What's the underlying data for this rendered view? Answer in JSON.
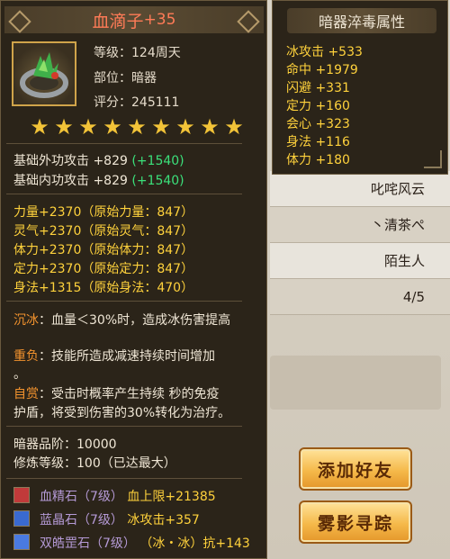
{
  "background": {
    "rows": [
      "叱咤风云",
      "丶清茶ぺ",
      "陌生人",
      "4/5"
    ],
    "buttons": {
      "add_friend": "添加好友",
      "track": "雾影寻踪"
    }
  },
  "tooltip": {
    "title": "血滴子",
    "title_plus": "+35",
    "level_label": "等级：",
    "level_value": "124周天",
    "slot_label": "部位：",
    "slot_value": "暗器",
    "score_label": "评分：",
    "score_value": "245111",
    "stars": [
      "★",
      "★",
      "★",
      "★",
      "★",
      "★",
      "★",
      "★",
      "★"
    ],
    "base_ext_attack": {
      "label": "基础外功攻击",
      "value": "+829",
      "bonus": "(+1540)"
    },
    "base_int_attack": {
      "label": "基础内功攻击",
      "value": "+829",
      "bonus": "(+1540)"
    },
    "attrs": [
      {
        "name": "力量",
        "value": "+2370",
        "orig": "（原始力量：",
        "orig_value": "847",
        "close": "）"
      },
      {
        "name": "灵气",
        "value": "+2370",
        "orig": "（原始灵气：",
        "orig_value": "847",
        "close": "）"
      },
      {
        "name": "体力",
        "value": "+2370",
        "orig": "（原始体力：",
        "orig_value": "847",
        "close": "）"
      },
      {
        "name": "定力",
        "value": "+2370",
        "orig": "（原始定力：",
        "orig_value": "847",
        "close": "）"
      },
      {
        "name": "身法",
        "value": "+1315",
        "orig": "（原始身法：",
        "orig_value": "470",
        "close": "）"
      }
    ],
    "skills": [
      {
        "name": "沉冰",
        "line1": "：血量＜30%时，造成冰伤害提高",
        "line2": ""
      },
      {
        "name": "重负",
        "line1": "：技能所造成减速持续时间增加",
        "line2": "。"
      },
      {
        "name": "自赏",
        "line1": "：受击时概率产生持续  秒的免疫",
        "line2": "护盾，将受到伤害的30%转化为治疗。"
      }
    ],
    "grade_label": "暗器品阶：",
    "grade_value": "10000",
    "refine_label": "修炼等级：",
    "refine_value": "100（已达最大）",
    "gems": [
      {
        "name": "血精石",
        "level": "（7级）",
        "effect": "血上限+21385",
        "color": "#c13a3a"
      },
      {
        "name": "蓝晶石",
        "level": "（7级）",
        "effect": "冰攻击+357",
        "color": "#3a6ad0"
      },
      {
        "name": "双皓罡石",
        "level": "（7级）",
        "effect": "（冰・冰）抗+143",
        "color": "#4a7ae0"
      }
    ]
  },
  "poison_panel": {
    "title": "暗器淬毒属性",
    "items": [
      {
        "name": "冰攻击",
        "value": "+533"
      },
      {
        "name": "命中",
        "value": "+1979"
      },
      {
        "name": "闪避",
        "value": "+331"
      },
      {
        "name": "定力",
        "value": "+160"
      },
      {
        "name": "会心",
        "value": "+323"
      },
      {
        "name": "身法",
        "value": "+116"
      },
      {
        "name": "体力",
        "value": "+180"
      }
    ]
  }
}
